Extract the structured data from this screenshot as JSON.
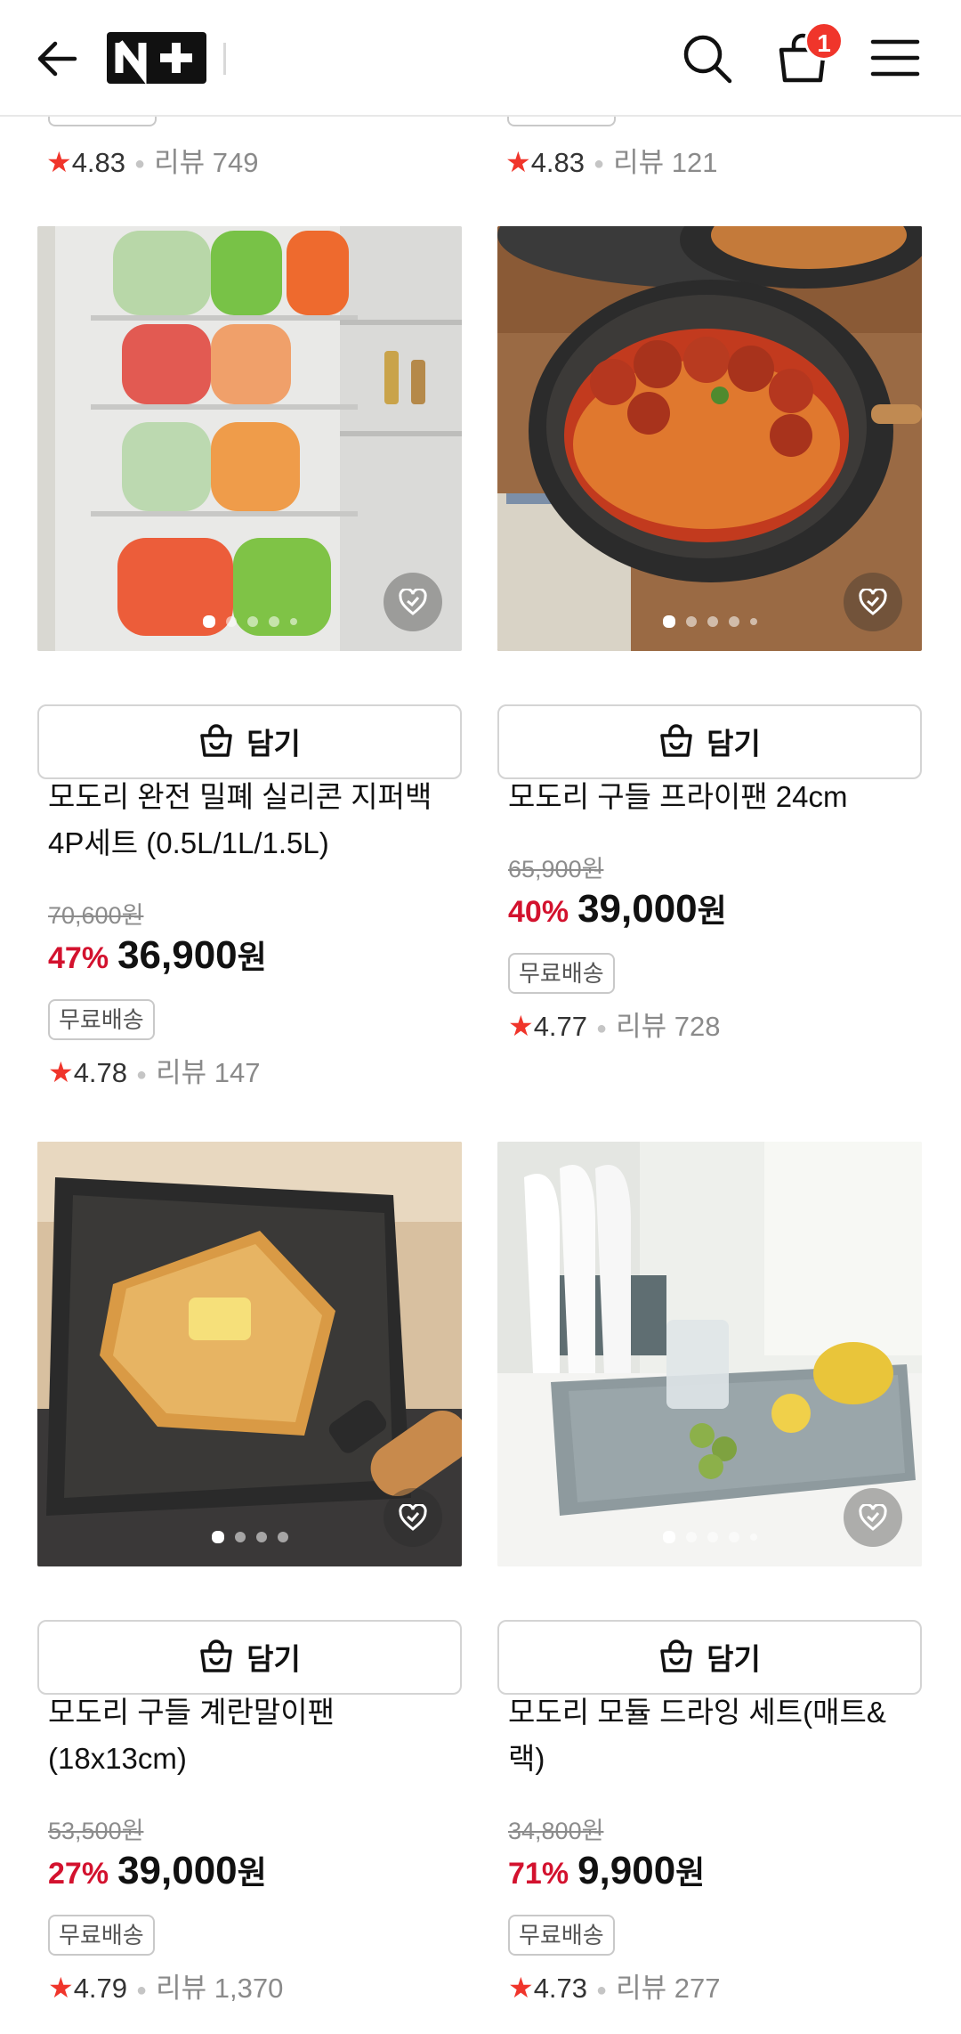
{
  "header": {
    "logo_text": "N+",
    "cart_count": "1",
    "icons": [
      "back-arrow-icon",
      "search-icon",
      "shopping-bag-icon",
      "hamburger-menu-icon"
    ]
  },
  "top_partial": [
    {
      "rating": "4.83",
      "review_label": "리뷰",
      "review_count": "749"
    },
    {
      "rating": "4.83",
      "review_label": "리뷰",
      "review_count": "121"
    }
  ],
  "products": [
    {
      "add_label": "담기",
      "name": "모도리 완전 밀폐 실리콘 지퍼백 4P세트 (0.5L/1L/1.5L)",
      "original_price": "70,600원",
      "discount": "47%",
      "price": "36,900",
      "currency": "원",
      "shipping_tag": "무료배송",
      "rating": "4.78",
      "review_label": "리뷰",
      "review_count": "147"
    },
    {
      "add_label": "담기",
      "name": "모도리 구들 프라이팬 24cm",
      "original_price": "65,900원",
      "discount": "40%",
      "price": "39,000",
      "currency": "원",
      "shipping_tag": "무료배송",
      "rating": "4.77",
      "review_label": "리뷰",
      "review_count": "728"
    },
    {
      "add_label": "담기",
      "name": "모도리 구들 계란말이팬 (18x13cm)",
      "original_price": "53,500원",
      "discount": "27%",
      "price": "39,000",
      "currency": "원",
      "shipping_tag": "무료배송",
      "rating": "4.79",
      "review_label": "리뷰",
      "review_count": "1,370"
    },
    {
      "add_label": "담기",
      "name": "모도리 모듈 드라잉 세트(매트&랙)",
      "original_price": "34,800원",
      "discount": "71%",
      "price": "9,900",
      "currency": "원",
      "shipping_tag": "무료배송",
      "rating": "4.73",
      "review_label": "리뷰",
      "review_count": "277"
    }
  ],
  "colors": {
    "discount": "#d3122e",
    "badge": "#f0352b",
    "star": "#f0352b"
  }
}
